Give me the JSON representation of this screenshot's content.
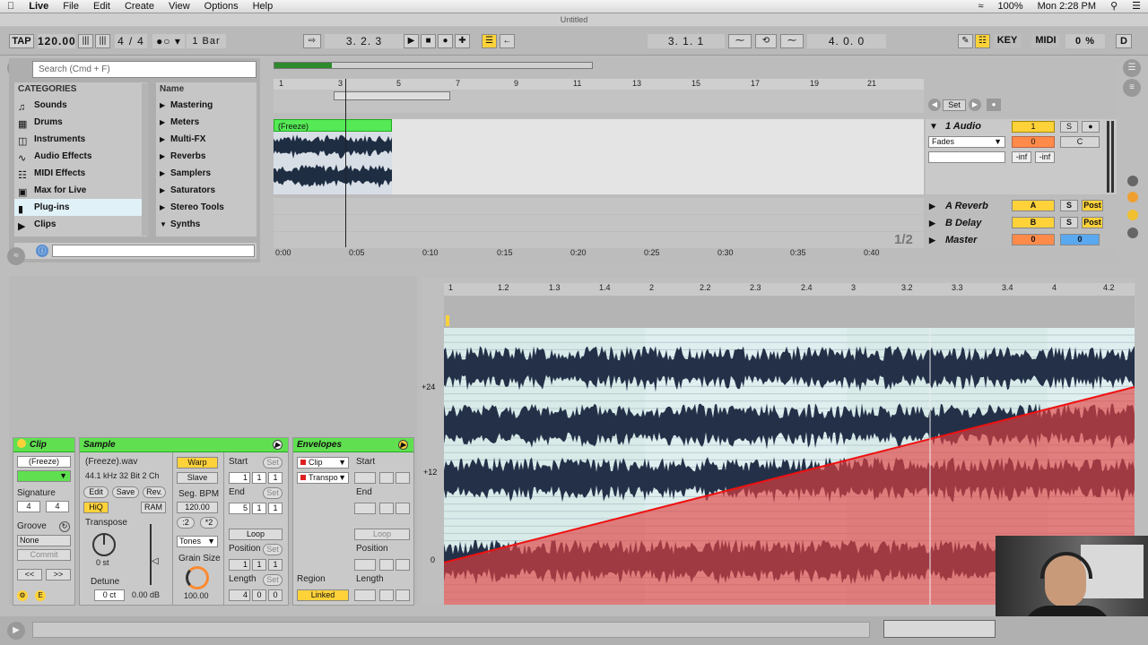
{
  "menubar": {
    "app": "Live",
    "items": [
      "File",
      "Edit",
      "Create",
      "View",
      "Options",
      "Help"
    ],
    "clock": "Mon 2:28 PM",
    "battery": "100%"
  },
  "window_title": "Untitled",
  "transport": {
    "tap": "TAP",
    "tempo": "120.00",
    "sig_num": "4",
    "sig_den": "4",
    "quantize": "1 Bar",
    "position": "3.   2.   3",
    "loop_start": "3.   1.   1",
    "loop_length": "4.   0.   0",
    "key": "KEY",
    "midi": "MIDI",
    "cpu": "0 %",
    "d": "D"
  },
  "browser": {
    "search_placeholder": "Search (Cmd + F)",
    "categories_header": "CATEGORIES",
    "name_header": "Name",
    "categories": [
      "Sounds",
      "Drums",
      "Instruments",
      "Audio Effects",
      "MIDI Effects",
      "Max for Live",
      "Plug-ins",
      "Clips"
    ],
    "names": [
      "Mastering",
      "Meters",
      "Multi-FX",
      "Reverbs",
      "Samplers",
      "Saturators",
      "Stereo Tools",
      "Synths"
    ]
  },
  "arrangement": {
    "bar_ticks": [
      "1",
      "3",
      "5",
      "7",
      "9",
      "11",
      "13",
      "15",
      "17",
      "19",
      "21"
    ],
    "time_ticks": [
      "0:00",
      "0:05",
      "0:10",
      "0:15",
      "0:20",
      "0:25",
      "0:30",
      "0:35",
      "0:40"
    ],
    "clip_name": "(Freeze)",
    "zoom": "1/2",
    "set_label": "Set"
  },
  "tracks": {
    "audio": {
      "name": "1 Audio",
      "number": "1",
      "solo": "S",
      "vol": "0",
      "pan": "C",
      "fades": "Fades",
      "inf1": "-inf",
      "inf2": "-inf"
    },
    "returns": [
      {
        "name": "A Reverb",
        "letter": "A",
        "solo": "S",
        "post": "Post"
      },
      {
        "name": "B Delay",
        "letter": "B",
        "solo": "S",
        "post": "Post"
      }
    ],
    "master": {
      "name": "Master",
      "vol": "0",
      "pan": "0"
    }
  },
  "clip_panel": {
    "title": "Clip",
    "name": "(Freeze)",
    "signature_label": "Signature",
    "sig_num": "4",
    "sig_den": "4",
    "groove_label": "Groove",
    "groove": "None",
    "commit": "Commit"
  },
  "sample_panel": {
    "title": "Sample",
    "file": "(Freeze).wav",
    "format": "44.1 kHz 32 Bit 2 Ch",
    "edit": "Edit",
    "save": "Save",
    "rev": "Rev.",
    "hiq": "HiQ",
    "ram": "RAM",
    "transpose_label": "Transpose",
    "transpose": "0 st",
    "detune_label": "Detune",
    "detune": "0 ct",
    "gain": "0.00 dB",
    "warp": "Warp",
    "slave": "Slave",
    "seg_bpm_label": "Seg. BPM",
    "seg_bpm": "120.00",
    "half": ":2",
    "double": "*2",
    "mode": "Tones",
    "grain_label": "Grain Size",
    "grain": "100.00",
    "start_label": "Start",
    "end_label": "End",
    "loop": "Loop",
    "position_label": "Position",
    "length_label": "Length",
    "set": "Set",
    "start": [
      "1",
      "1",
      "1"
    ],
    "end": [
      "5",
      "1",
      "1"
    ],
    "position": [
      "1",
      "1",
      "1"
    ],
    "length": [
      "4",
      "0",
      "0"
    ]
  },
  "envelopes_panel": {
    "title": "Envelopes",
    "source": "Clip",
    "control": "Transpo",
    "start_label": "Start",
    "end_label": "End",
    "loop": "Loop",
    "position_label": "Position",
    "region_label": "Region",
    "linked": "Linked",
    "length_label": "Length"
  },
  "wave_view": {
    "ruler": [
      "1",
      "1.2",
      "1.3",
      "1.4",
      "2",
      "2.2",
      "2.3",
      "2.4",
      "3",
      "3.2",
      "3.3",
      "3.4",
      "4",
      "4.2"
    ],
    "y_labels": [
      "+24",
      "+12",
      "0"
    ]
  },
  "colors": {
    "clip_green": "#60e050",
    "accent_yellow": "#ffd23a",
    "orange": "#ff8a4a",
    "envelope_red": "#e02020"
  }
}
